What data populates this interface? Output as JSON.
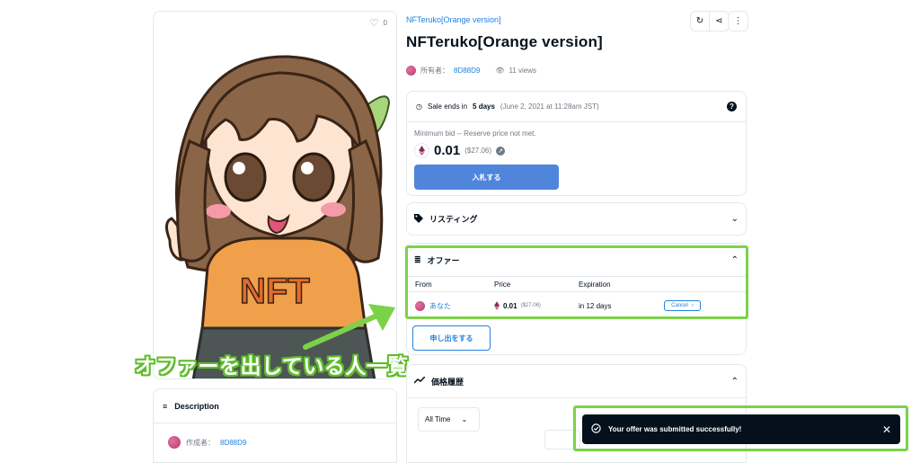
{
  "item": {
    "favorites_count": "0",
    "collection": "NFTeruko[Orange version]",
    "title": "NFTeruko[Orange version]",
    "owner_label": "所有者：",
    "owner_name": "8D88D9",
    "views": "11 views"
  },
  "description": {
    "heading": "Description",
    "creator_label": "作成者：",
    "creator_name": "8D88D9"
  },
  "sale": {
    "ends_prefix": "Sale ends in ",
    "ends_bold": "5 days",
    "ends_detail": "(June 2, 2021 at 11:28am JST)",
    "help": "?",
    "min_bid_text": "Minimum bid -- Reserve price not met.",
    "price": "0.01",
    "price_usd": "($27.06)",
    "bid_button": "入札する"
  },
  "listings": {
    "heading": "リスティング"
  },
  "offers": {
    "heading": "オファー",
    "columns": [
      "From",
      "Price",
      "Expiration"
    ],
    "rows": [
      {
        "from": "あなた",
        "price": "0.01",
        "price_usd": "($27.06)",
        "expiration": "in 12 days",
        "action": "Cancel"
      }
    ],
    "make_offer_button": "申し出をする"
  },
  "price_history": {
    "heading": "価格履歴",
    "range_selected": "All Time"
  },
  "annotation": "オファーを出している人一覧",
  "toast": {
    "message": "Your offer was submitted successfully!"
  },
  "colors": {
    "accent": "#2081e2",
    "bid_button": "#4f86dc",
    "highlight": "#7bd249",
    "toast_bg": "#04111d"
  }
}
